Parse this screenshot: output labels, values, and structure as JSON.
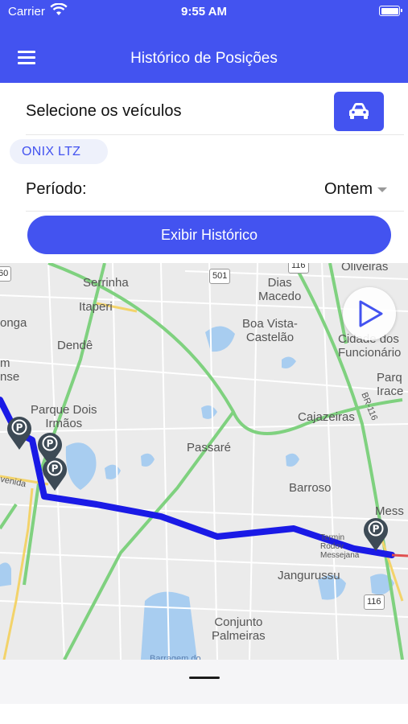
{
  "status_bar": {
    "carrier": "Carrier",
    "time": "9:55 AM"
  },
  "header": {
    "title": "Histórico de Posições",
    "menu_icon": "hamburger-menu-icon"
  },
  "form": {
    "vehicles_label": "Selecione os veículos",
    "vehicle_button_icon": "car-icon",
    "selected_vehicle": "ONIX LTZ",
    "period_label": "Período:",
    "period_value": "Ontem",
    "submit_label": "Exibir Histórico"
  },
  "map": {
    "labels": {
      "serrinha": "Serrinha",
      "itaperi": "Itaperi",
      "dende": "Dendê",
      "parque_dois_irmaos": "Parque Dois\nIrmãos",
      "dias_macedo": "Dias\nMacedo",
      "boa_vista": "Boa Vista-\nCastelão",
      "oliveiras": "Oliveiras",
      "cidade_funcionarios": "Cidade dos\nFuncionário",
      "parque_iracema": "Parq\nIrace",
      "cajazeiras": "Cajazeiras",
      "passare": "Passaré",
      "barroso": "Barroso",
      "messejana": "Mess",
      "jangurussu": "Jangurussu",
      "conjunto_palmeiras": "Conjunto\nPalmeiras",
      "terminal": "Termin\nRodov\nMessejana",
      "avenida": "venida",
      "longa": "onga",
      "mense": "m\nnse",
      "br116": "BR-116",
      "road_501": "501",
      "road_116": "116",
      "road_116_top": "116",
      "road_60": "60",
      "barragem": "Barragem do"
    },
    "play_button_icon": "play-icon",
    "route_color": "#1a1ae6",
    "marker_icon": "parking-marker-icon",
    "marker_color": "#3d4a55"
  },
  "colors": {
    "accent": "#4353f0",
    "chip_bg": "#eef1fb"
  }
}
